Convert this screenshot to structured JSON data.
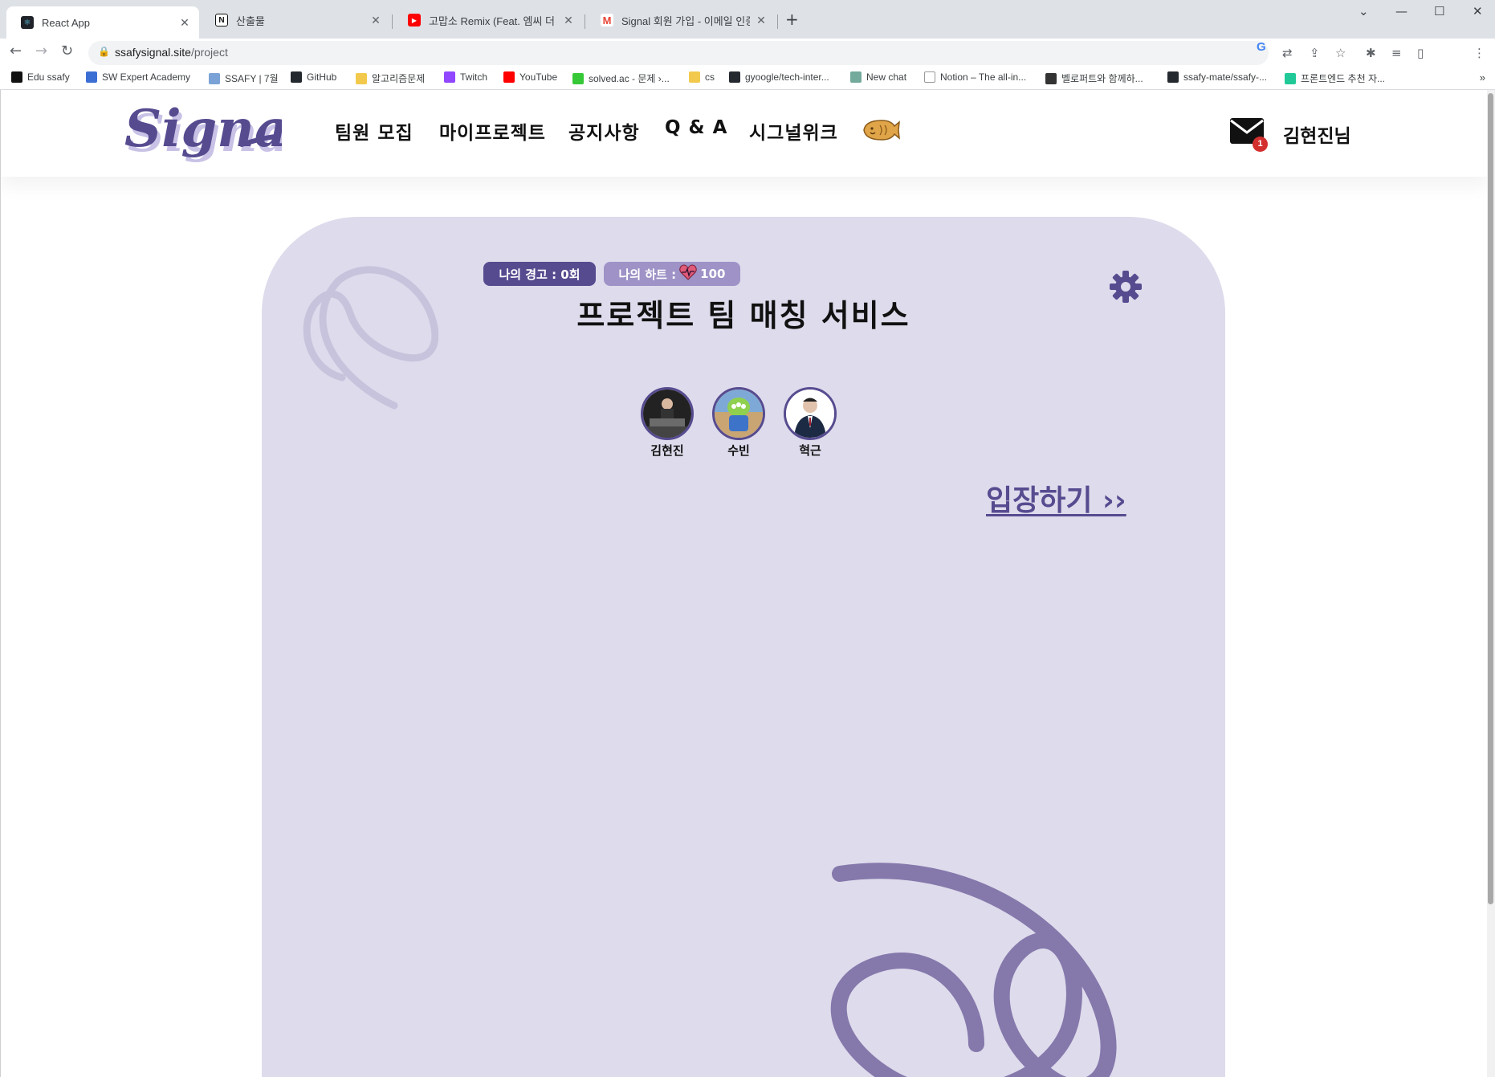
{
  "browser": {
    "tabs": [
      {
        "label": "React App",
        "active": true
      },
      {
        "label": "산출물",
        "active": false
      },
      {
        "label": "고맙소 Remix (Feat. 엠씨 더 힝",
        "active": false
      },
      {
        "label": "Signal 회원 가입 - 이메일 인증",
        "active": false
      }
    ],
    "new_tab": "+",
    "url_host": "ssafysignal.site",
    "url_path": "/project",
    "bookmarks": [
      {
        "label": "Edu ssafy",
        "color": "#111111"
      },
      {
        "label": "SW Expert Academy",
        "color": "#3b6fd4"
      },
      {
        "label": "SSAFY | 7월",
        "color": "#7aa2d6"
      },
      {
        "label": "GitHub",
        "color": "#24292f"
      },
      {
        "label": "알고리즘문제",
        "color": "#f2c94c"
      },
      {
        "label": "Twitch",
        "color": "#9146ff"
      },
      {
        "label": "YouTube",
        "color": "#ff0000"
      },
      {
        "label": "solved.ac - 문제 ›...",
        "color": "#37c837"
      },
      {
        "label": "cs",
        "color": "#f2c94c"
      },
      {
        "label": "gyoogle/tech-inter...",
        "color": "#24292f"
      },
      {
        "label": "New chat",
        "color": "#74aa9c"
      },
      {
        "label": "Notion – The all-in...",
        "color": "#ffffff"
      },
      {
        "label": "벨로퍼트와 함께하...",
        "color": "#333333"
      },
      {
        "label": "ssafy-mate/ssafy-...",
        "color": "#24292f"
      },
      {
        "label": "프론트엔드 추천 자...",
        "color": "#20c997"
      }
    ],
    "bookmarks_more": "»"
  },
  "header": {
    "logo_text": "Signal",
    "nav": [
      "팀원 모집",
      "마이프로젝트",
      "공지사항",
      "Q & A",
      "시그널위크"
    ],
    "mail_badge": "1",
    "username": "김현진님"
  },
  "project": {
    "warning_chip": "나의 경고 : 0회",
    "heart_label": "나의 하트 :",
    "heart_value": "100",
    "title": "프로젝트 팀 매칭 서비스",
    "members": [
      {
        "name": "김현진"
      },
      {
        "name": "수빈"
      },
      {
        "name": "혁근"
      }
    ],
    "enter_label": "입장하기 ››"
  },
  "colors": {
    "brand": "#574b90",
    "brand_light": "#9e92c6",
    "card_bg": "#dedbec",
    "badge": "#d32f2f"
  }
}
